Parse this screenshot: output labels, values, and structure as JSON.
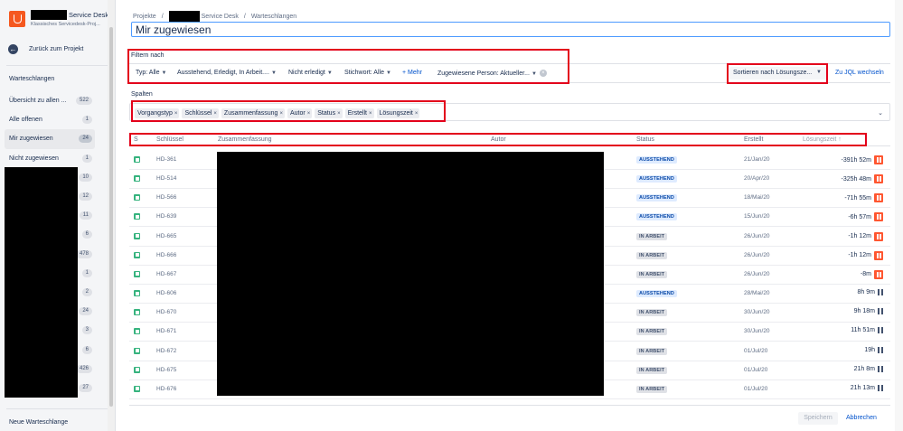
{
  "project": {
    "name_suffix": "Service Desk",
    "subtitle": "Klassisches Servicedesk-Proj..."
  },
  "sidebar": {
    "back_label": "Zurück zum Projekt",
    "section_title": "Warteschlangen",
    "queues": [
      {
        "label": "Übersicht zu allen ...",
        "count": "522"
      },
      {
        "label": "Alle offenen",
        "count": "1"
      },
      {
        "label": "Mir zugewiesen",
        "count": "24"
      },
      {
        "label": "Nicht zugewiesen",
        "count": "1"
      },
      {
        "label": "",
        "count": "10"
      },
      {
        "label": "",
        "count": "12"
      },
      {
        "label": "",
        "count": "11"
      },
      {
        "label": "",
        "count": "6"
      },
      {
        "label": "",
        "count": "478"
      },
      {
        "label": "",
        "count": "1"
      },
      {
        "label": "",
        "count": "2"
      },
      {
        "label": "",
        "count": "24"
      },
      {
        "label": "",
        "count": "3"
      },
      {
        "label": "",
        "count": "6"
      },
      {
        "label": "",
        "count": "426"
      },
      {
        "label": "",
        "count": "27"
      }
    ],
    "new_queue_label": "Neue Warteschlange"
  },
  "breadcrumb": {
    "projects": "Projekte",
    "sep": "/",
    "project_suffix": "Service Desk",
    "queues": "Warteschlangen"
  },
  "page": {
    "title": "Mir zugewiesen"
  },
  "filters": {
    "label": "Filtern nach",
    "type": "Typ: Alle",
    "status": "Ausstehend, Erledigt, In Arbeit....",
    "resolution": "Nicht erledigt",
    "keyword": "Stichwort: Alle",
    "more": "Mehr",
    "more_plus": "+",
    "assignee": "Zugewiesene Person: Aktueller...",
    "clear": "×",
    "sort": "Sortieren nach Lösungsze...",
    "jql": "Zu JQL wechseln"
  },
  "columns": {
    "label": "Spalten",
    "chips": [
      "Vorgangstyp",
      "Schlüssel",
      "Zusammenfassung",
      "Autor",
      "Status",
      "Erstellt",
      "Lösungszeit"
    ],
    "chip_remove": "×",
    "dropdown": "⌄"
  },
  "table": {
    "headers": {
      "type": "S",
      "key": "Schlüssel",
      "summary": "Zusammenfassung",
      "author": "Autor",
      "status": "Status",
      "created": "Erstellt",
      "sla": "Lösungszeit ↑"
    },
    "rows": [
      {
        "key": "HD-361",
        "status": "AUSSTEHEND",
        "created": "21/Jan/20",
        "sla": "-391h 52m",
        "paused_breached": true
      },
      {
        "key": "HD-514",
        "status": "AUSSTEHEND",
        "created": "20/Apr/20",
        "sla": "-325h 48m",
        "paused_breached": true
      },
      {
        "key": "HD-566",
        "status": "AUSSTEHEND",
        "created": "18/Mai/20",
        "sla": "-71h 55m",
        "paused_breached": true
      },
      {
        "key": "HD-639",
        "status": "AUSSTEHEND",
        "created": "15/Jun/20",
        "sla": "-6h 57m",
        "paused_breached": true
      },
      {
        "key": "HD-665",
        "status": "IN ARBEIT",
        "created": "26/Jun/20",
        "sla": "-1h 12m",
        "paused_breached": true
      },
      {
        "key": "HD-666",
        "status": "IN ARBEIT",
        "created": "26/Jun/20",
        "sla": "-1h 12m",
        "paused_breached": true
      },
      {
        "key": "HD-667",
        "status": "IN ARBEIT",
        "created": "26/Jun/20",
        "sla": "-8m",
        "paused_breached": true
      },
      {
        "key": "HD-606",
        "status": "AUSSTEHEND",
        "created": "28/Mai/20",
        "sla": "8h 9m",
        "paused_breached": false
      },
      {
        "key": "HD-670",
        "status": "IN ARBEIT",
        "created": "30/Jun/20",
        "sla": "9h 18m",
        "paused_breached": false
      },
      {
        "key": "HD-671",
        "status": "IN ARBEIT",
        "created": "30/Jun/20",
        "sla": "11h 51m",
        "paused_breached": false
      },
      {
        "key": "HD-672",
        "status": "IN ARBEIT",
        "created": "01/Jul/20",
        "sla": "19h",
        "paused_breached": false
      },
      {
        "key": "HD-675",
        "status": "IN ARBEIT",
        "created": "01/Jul/20",
        "sla": "21h 8m",
        "paused_breached": false
      },
      {
        "key": "HD-676",
        "status": "IN ARBEIT",
        "created": "01/Jul/20",
        "sla": "21h 13m",
        "paused_breached": false
      }
    ]
  },
  "footer": {
    "save": "Speichern",
    "cancel": "Abbrechen"
  },
  "colors": {
    "annotation_red": "#e3001b",
    "link_blue": "#0052cc",
    "status_pending_bg": "#deebff",
    "status_progress_bg": "#dfe1e6",
    "sla_breached": "#ff5630",
    "type_icon_green": "#36b37e"
  }
}
